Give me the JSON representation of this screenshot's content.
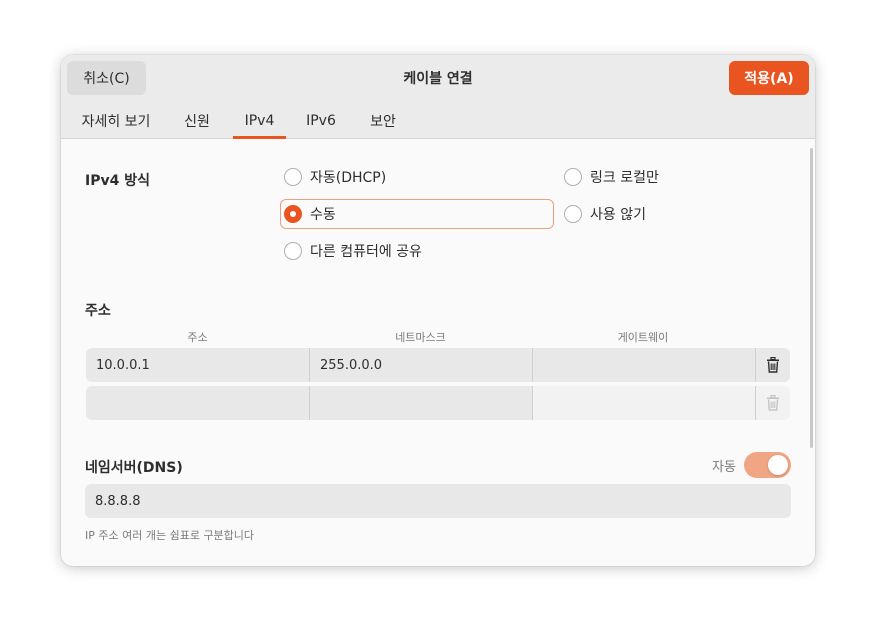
{
  "header": {
    "cancel_label": "취소(C)",
    "title": "케이블 연결",
    "apply_label": "적용(A)"
  },
  "tabs": [
    {
      "label": "자세히 보기"
    },
    {
      "label": "신원"
    },
    {
      "label": "IPv4"
    },
    {
      "label": "IPv6"
    },
    {
      "label": "보안"
    }
  ],
  "active_tab": "IPv4",
  "ipv4": {
    "method_label": "IPv4 방식",
    "methods": [
      {
        "label": "자동(DHCP)",
        "selected": false
      },
      {
        "label": "링크 로컬만",
        "selected": false
      },
      {
        "label": "수동",
        "selected": true
      },
      {
        "label": "사용 않기",
        "selected": false
      },
      {
        "label": "다른 컴퓨터에 공유",
        "selected": false
      }
    ]
  },
  "addresses": {
    "section_label": "주소",
    "columns": [
      "주소",
      "네트마스크",
      "게이트웨이"
    ],
    "rows": [
      {
        "address": "10.0.0.1",
        "netmask": "255.0.0.0",
        "gateway": ""
      },
      {
        "address": "",
        "netmask": "",
        "gateway": ""
      }
    ]
  },
  "dns": {
    "section_label": "네임서버(DNS)",
    "auto_label": "자동",
    "auto_enabled": true,
    "value": "8.8.8.8",
    "hint": "IP 주소 여러 개는 쉼표로 구분합니다"
  },
  "colors": {
    "accent": "#e95420",
    "toggle_on": "#f0a585"
  }
}
